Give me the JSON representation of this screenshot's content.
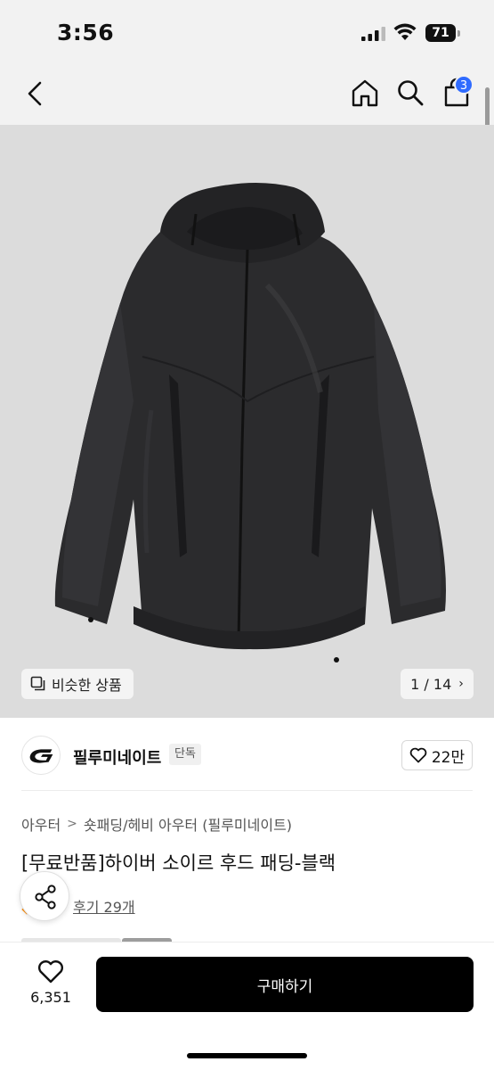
{
  "status_bar": {
    "time": "3:56",
    "battery": "71"
  },
  "nav": {
    "cart_count": "3",
    "badge_color": "#2f6bff"
  },
  "gallery": {
    "similar_label": "비슷한 상품",
    "page_current": "1",
    "page_total": "14",
    "page_text": "1 / 14",
    "background_color": "#dcdcdc"
  },
  "brand": {
    "name": "필루미네이트",
    "badge": "단독",
    "likes": "22만"
  },
  "product": {
    "breadcrumb": [
      "아우터",
      "숏패딩/헤비 아우터 (필루미네이트)"
    ],
    "title": "[무료반품]하이버 소이르 후드 패딩-블랙",
    "reviews": "후기 29개"
  },
  "bottom_bar": {
    "wish_count": "6,351",
    "buy_label": "구매하기",
    "buy_color": "#000000"
  }
}
